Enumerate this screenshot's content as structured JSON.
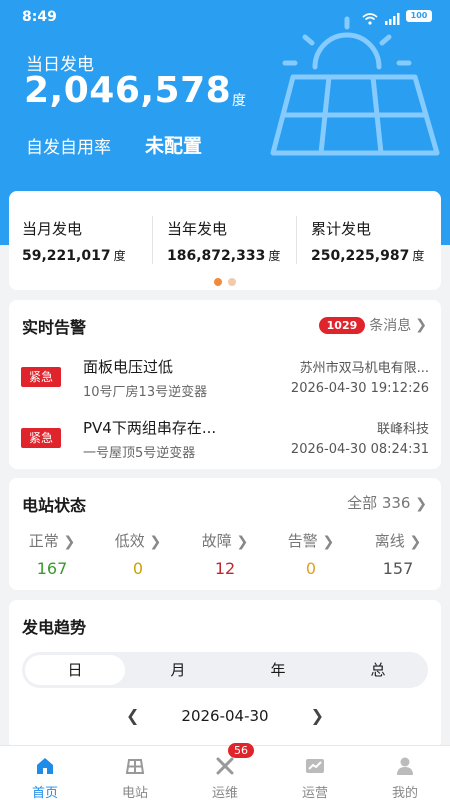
{
  "status_bar": {
    "time": "8:49",
    "battery": "100"
  },
  "header": {
    "today_label": "当日发电",
    "today_value": "2,046,578",
    "today_unit": "度",
    "selfuse_label": "自发自用率",
    "selfuse_value": "未配置"
  },
  "stats": [
    {
      "label": "当月发电",
      "value": "59,221,017",
      "unit": "度"
    },
    {
      "label": "当年发电",
      "value": "186,872,333",
      "unit": "度"
    },
    {
      "label": "累计发电",
      "value": "250,225,987",
      "unit": "度"
    }
  ],
  "alarms": {
    "title": "实时告警",
    "count": "1029",
    "count_suffix": "条消息",
    "items": [
      {
        "tag": "紧急",
        "title": "面板电压过低",
        "device": "10号厂房13号逆变器",
        "company": "苏州市双马机电有限...",
        "time": "2026-04-30 19:12:26"
      },
      {
        "tag": "紧急",
        "title": "PV4下两组串存在...",
        "device": "一号屋顶5号逆变器",
        "company": "联峰科技",
        "time": "2026-04-30 08:24:31"
      }
    ]
  },
  "station_status": {
    "title": "电站状态",
    "all_label": "全部 336",
    "items": [
      {
        "label": "正常",
        "value": "167",
        "color": "#3a9a2a"
      },
      {
        "label": "低效",
        "value": "0",
        "color": "#c9a400"
      },
      {
        "label": "故障",
        "value": "12",
        "color": "#c0282d"
      },
      {
        "label": "告警",
        "value": "0",
        "color": "#e0a020"
      },
      {
        "label": "离线",
        "value": "157",
        "color": "#555555"
      }
    ]
  },
  "trend": {
    "title": "发电趋势",
    "tabs": [
      "日",
      "月",
      "年",
      "总"
    ],
    "active_tab": "日",
    "date": "2026-04-30"
  },
  "bottom_nav": [
    {
      "label": "首页",
      "icon": "home-icon",
      "active": true
    },
    {
      "label": "电站",
      "icon": "station-icon",
      "active": false
    },
    {
      "label": "运维",
      "icon": "tools-icon",
      "active": false,
      "badge": "56"
    },
    {
      "label": "运营",
      "icon": "chart-icon",
      "active": false
    },
    {
      "label": "我的",
      "icon": "user-icon",
      "active": false
    }
  ],
  "colors": {
    "primary": "#2a9ef0",
    "urgent": "#e0242b",
    "nav_active": "#1f8ce8"
  }
}
